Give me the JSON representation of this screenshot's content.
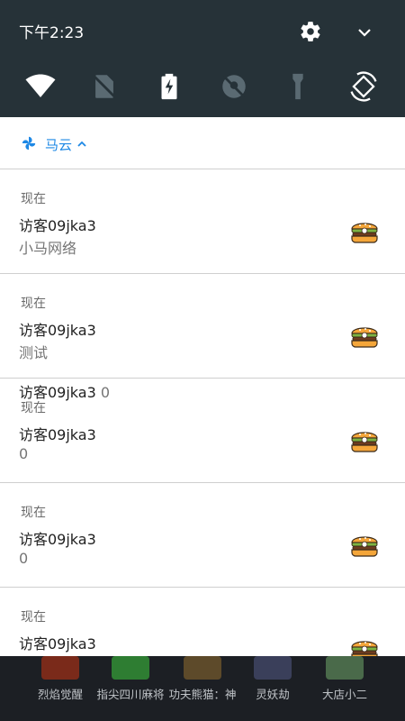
{
  "status_bar": {
    "time": "下午2:23"
  },
  "quick_settings": [
    {
      "icon": "wifi-icon"
    },
    {
      "icon": "no-sim-icon"
    },
    {
      "icon": "battery-charging-icon"
    },
    {
      "icon": "location-off-icon"
    },
    {
      "icon": "flashlight-icon"
    },
    {
      "icon": "auto-rotate-icon"
    }
  ],
  "app_header": {
    "name": "马云"
  },
  "notifications": [
    {
      "when": "现在",
      "title": "访客09jka3",
      "text": "小马网络"
    },
    {
      "when": "现在",
      "title": "访客09jka3",
      "text": "测试"
    },
    {
      "when": "现在",
      "title": "访客09jka3",
      "text": "0"
    },
    {
      "when": "现在",
      "title": "访客09jka3",
      "text": "0"
    },
    {
      "when": "现在",
      "title": "访客09jka3",
      "text": ""
    }
  ],
  "overlap_line": {
    "title": "访客09jka3",
    "text": "0"
  },
  "tray_apps": [
    {
      "label": "烈焰觉醒",
      "color": "#7a2a1a"
    },
    {
      "label": "指尖四川麻将",
      "color": "#2e7d32"
    },
    {
      "label": "功夫熊猫：神",
      "color": "#5d4a2a"
    },
    {
      "label": "灵妖劫",
      "color": "#3a3f5a"
    },
    {
      "label": "大店小二",
      "color": "#4a6a4a"
    }
  ],
  "colors": {
    "accent": "#1e88e5",
    "shade": "#263238"
  }
}
